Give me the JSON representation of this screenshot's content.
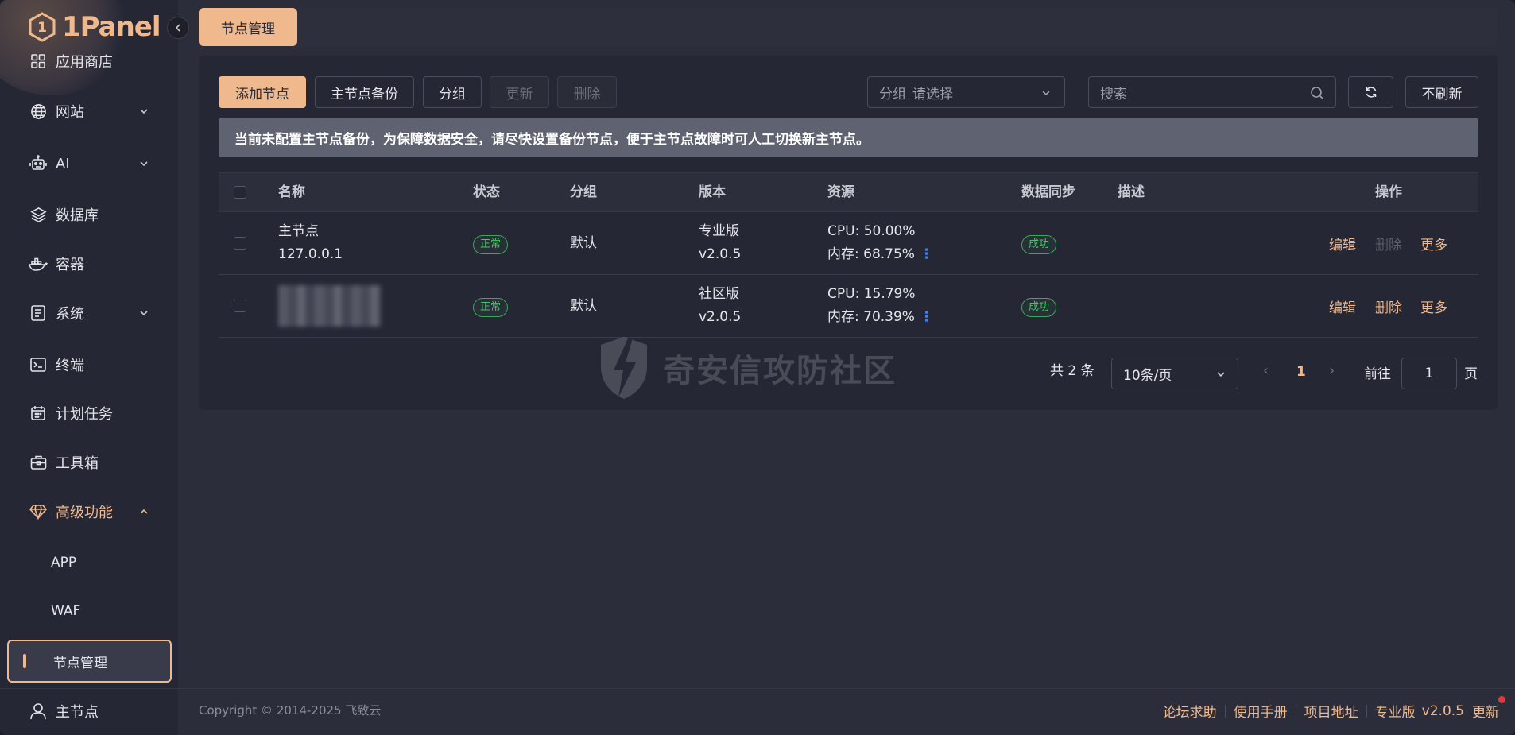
{
  "app": {
    "logo_text": "1Panel"
  },
  "sidebar": {
    "items": [
      {
        "label": "应用商店",
        "icon": "grid-icon"
      },
      {
        "label": "网站",
        "icon": "globe-icon"
      },
      {
        "label": "AI",
        "icon": "robot-icon"
      },
      {
        "label": "数据库",
        "icon": "layers-icon"
      },
      {
        "label": "容器",
        "icon": "docker-icon"
      },
      {
        "label": "系统",
        "icon": "system-icon"
      },
      {
        "label": "终端",
        "icon": "terminal-icon"
      },
      {
        "label": "计划任务",
        "icon": "calendar-icon"
      },
      {
        "label": "工具箱",
        "icon": "toolbox-icon"
      },
      {
        "label": "高级功能",
        "icon": "diamond-icon"
      }
    ],
    "sub_items": [
      {
        "label": "APP"
      },
      {
        "label": "WAF"
      },
      {
        "label": "节点管理"
      }
    ],
    "bottom_label": "主节点"
  },
  "topbar": {
    "active_tab": "节点管理"
  },
  "toolbar": {
    "add_node": "添加节点",
    "master_backup": "主节点备份",
    "group": "分组",
    "update": "更新",
    "delete": "删除",
    "group_select_prefix": "分组",
    "group_select_placeholder": "请选择",
    "search_placeholder": "搜索",
    "no_refresh": "不刷新"
  },
  "alert": {
    "text": "当前未配置主节点备份，为保障数据安全，请尽快设置备份节点，便于主节点故障时可人工切换新主节点。"
  },
  "table": {
    "headers": {
      "name": "名称",
      "status": "状态",
      "group": "分组",
      "version": "版本",
      "resources": "资源",
      "sync": "数据同步",
      "desc": "描述",
      "actions": "操作"
    },
    "rows": [
      {
        "name": "主节点",
        "ip": "127.0.0.1",
        "status": "正常",
        "group": "默认",
        "edition": "专业版",
        "version": "v2.0.5",
        "cpu": "CPU: 50.00%",
        "mem": "内存: 68.75%",
        "sync": "成功",
        "edit": "编辑",
        "delete": "删除",
        "more": "更多"
      },
      {
        "name": "",
        "ip": "",
        "status": "正常",
        "group": "默认",
        "edition": "社区版",
        "version": "v2.0.5",
        "cpu": "CPU: 15.79%",
        "mem": "内存: 70.39%",
        "sync": "成功",
        "edit": "编辑",
        "delete": "删除",
        "more": "更多"
      }
    ]
  },
  "pagination": {
    "total": "共 2 条",
    "page_size": "10条/页",
    "current": "1",
    "goto_label": "前往",
    "goto_value": "1",
    "page_suffix": "页"
  },
  "watermark": {
    "text": "奇安信攻防社区"
  },
  "footer": {
    "copyright": "Copyright © 2014-2025 飞致云",
    "links": [
      "论坛求助",
      "使用手册",
      "项目地址",
      "专业版"
    ],
    "version": "v2.0.5",
    "update": "更新"
  },
  "colors": {
    "accent": "#f0b98d",
    "success": "#4ac46a",
    "background": "#2b2d3b",
    "sidebar": "#252735"
  }
}
